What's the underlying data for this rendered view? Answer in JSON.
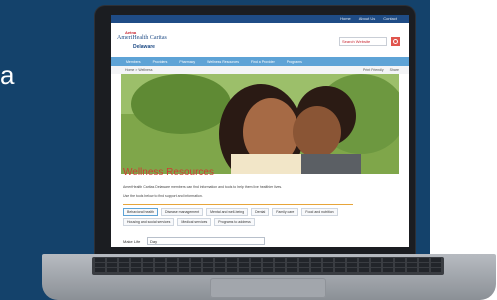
{
  "promo": {
    "left_text": "a"
  },
  "site": {
    "top_links": [
      "Home",
      "About Us",
      "Contact"
    ],
    "brand": "Aetna",
    "title": "AmeriHealth Caritas",
    "subtitle": "Delaware",
    "search": {
      "value": "Search Website"
    },
    "nav": [
      "Members",
      "Providers",
      "Pharmacy",
      "Wellness Resources",
      "Find a Provider",
      "Programs"
    ],
    "breadcrumb": "Home > Wellness",
    "tools": [
      "Print Friendly",
      "Share"
    ],
    "page_title": "Wellness Resources",
    "intro": "AmeriHealth Caritas Delaware members can find information and tools to help them live healthier lives.",
    "intro2": "Use the tools below to find support and information.",
    "categories": [
      {
        "label": "Behavioral health",
        "active": true
      },
      {
        "label": "Disease management",
        "active": false
      },
      {
        "label": "Mental and well-being",
        "active": false
      },
      {
        "label": "Dental",
        "active": false
      },
      {
        "label": "Family care",
        "active": false
      },
      {
        "label": "Food and nutrition",
        "active": false
      },
      {
        "label": "Housing and social services",
        "active": false
      },
      {
        "label": "Medical services",
        "active": false
      },
      {
        "label": "Programs to address",
        "active": false
      }
    ],
    "filter_label": "Make Life",
    "filter_value": "Day"
  }
}
